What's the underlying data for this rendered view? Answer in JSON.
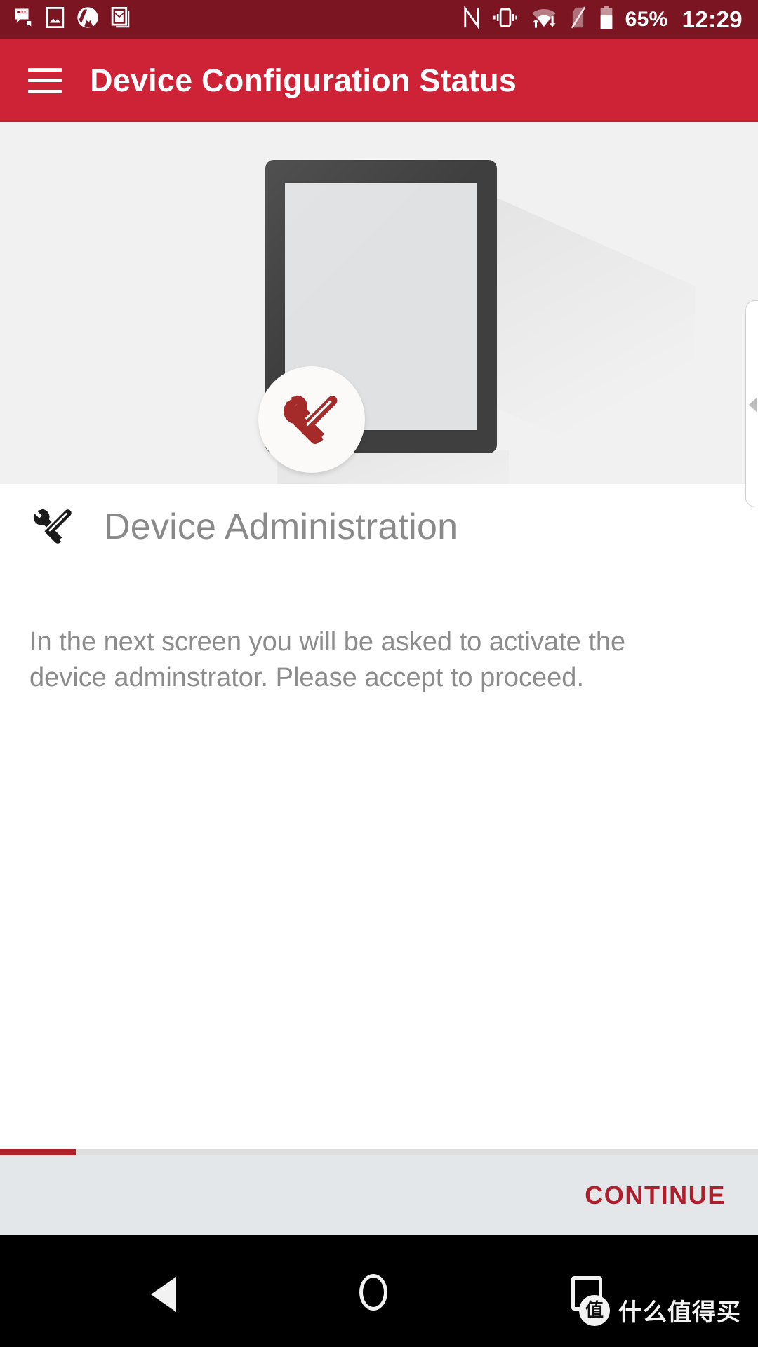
{
  "theme": {
    "status_bar_bg": "#7B1522",
    "app_bar_bg": "#CE2236",
    "accent": "#AF1E2D",
    "hero_bg": "#F1F1F1",
    "footer_bg": "#E3E7E9",
    "body_text": "#8C8C8C",
    "nav_bg": "#000000"
  },
  "status_bar": {
    "left_icons": [
      {
        "name": "messaging-icon",
        "label": "Messaging"
      },
      {
        "name": "gallery-icon",
        "label": "Gallery"
      },
      {
        "name": "mountain-app-icon",
        "label": "App"
      },
      {
        "name": "gmail-icon",
        "label": "Gmail"
      }
    ],
    "right_icons": [
      {
        "name": "nfc-icon",
        "label": "NFC"
      },
      {
        "name": "vibrate-icon",
        "label": "Vibrate"
      },
      {
        "name": "wifi-activity-alert-icon",
        "label": "Wi-Fi no internet"
      },
      {
        "name": "no-sim-icon",
        "label": "No SIM"
      },
      {
        "name": "battery-icon",
        "label": "Battery"
      }
    ],
    "battery_percent": "65%",
    "clock": "12:29"
  },
  "app_bar": {
    "menu_icon": "hamburger-menu-icon",
    "title": "Device Configuration Status"
  },
  "hero": {
    "illustration": "tablet-with-tools-illustration",
    "badge_icon": "wrench-screwdriver-icon"
  },
  "section": {
    "icon": "wrench-screwdriver-icon",
    "title": "Device Administration",
    "body": "In the next screen you will be asked to activate the device adminstrator. Please accept to proceed."
  },
  "edge_panel": {
    "name": "edge-panel-handle",
    "arrow_icon": "chevron-left-icon"
  },
  "footer": {
    "progress_percent": 10,
    "continue_label": "CONTINUE"
  },
  "nav_bar": {
    "back_icon": "back-triangle-icon",
    "home_icon": "home-circle-icon",
    "recents_icon": "recents-square-icon"
  },
  "watermark": {
    "badge": "值",
    "text": "什么值得买"
  }
}
